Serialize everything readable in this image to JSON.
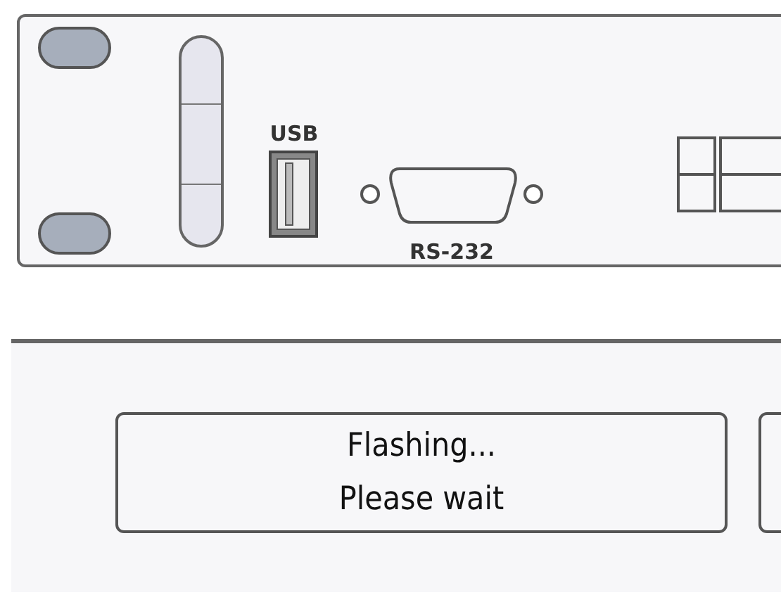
{
  "panel": {
    "usb_label": "USB",
    "serial_label": "RS-232"
  },
  "display": {
    "lines": [
      "Flashing...",
      "Please wait"
    ]
  }
}
